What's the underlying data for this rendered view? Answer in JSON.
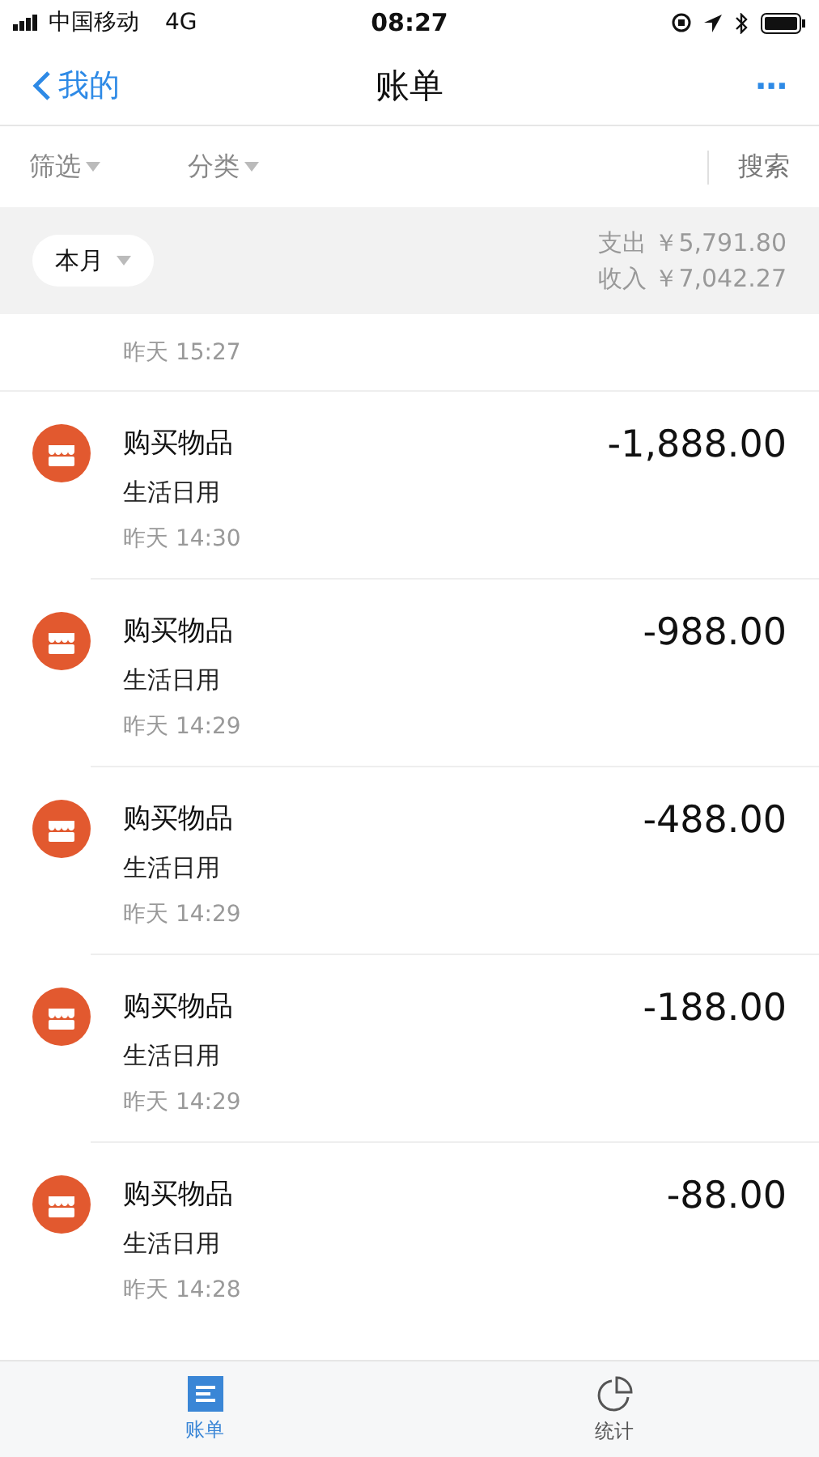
{
  "status_bar": {
    "carrier": "中国移动",
    "network": "4G",
    "time": "08:27"
  },
  "nav": {
    "back": "我的",
    "title": "账单",
    "more": "···"
  },
  "filters": [
    {
      "label": "筛选"
    },
    {
      "label": "分类"
    }
  ],
  "search": "搜索",
  "period": "本月",
  "summary": [
    {
      "label": "支出",
      "value": "￥5,791.80"
    },
    {
      "label": "收入",
      "value": "￥7,042.27"
    }
  ],
  "partial_item": {
    "date": "昨天",
    "time": "15:27"
  },
  "transactions": [
    {
      "title": "购买物品",
      "category": "生活日用",
      "date": "昨天",
      "time": "14:30",
      "amount": "-1,888.00"
    },
    {
      "title": "购买物品",
      "category": "生活日用",
      "date": "昨天",
      "time": "14:29",
      "amount": "-988.00"
    },
    {
      "title": "购买物品",
      "category": "生活日用",
      "date": "昨天",
      "time": "14:29",
      "amount": "-488.00"
    },
    {
      "title": "购买物品",
      "category": "生活日用",
      "date": "昨天",
      "time": "14:29",
      "amount": "-188.00"
    },
    {
      "title": "购买物品",
      "category": "生活日用",
      "date": "昨天",
      "time": "14:28",
      "amount": "-88.00"
    }
  ],
  "tab_bar": [
    {
      "label": "账单",
      "kind": "bill",
      "selected": true
    },
    {
      "label": "统计",
      "kind": "stats",
      "selected": false
    }
  ]
}
